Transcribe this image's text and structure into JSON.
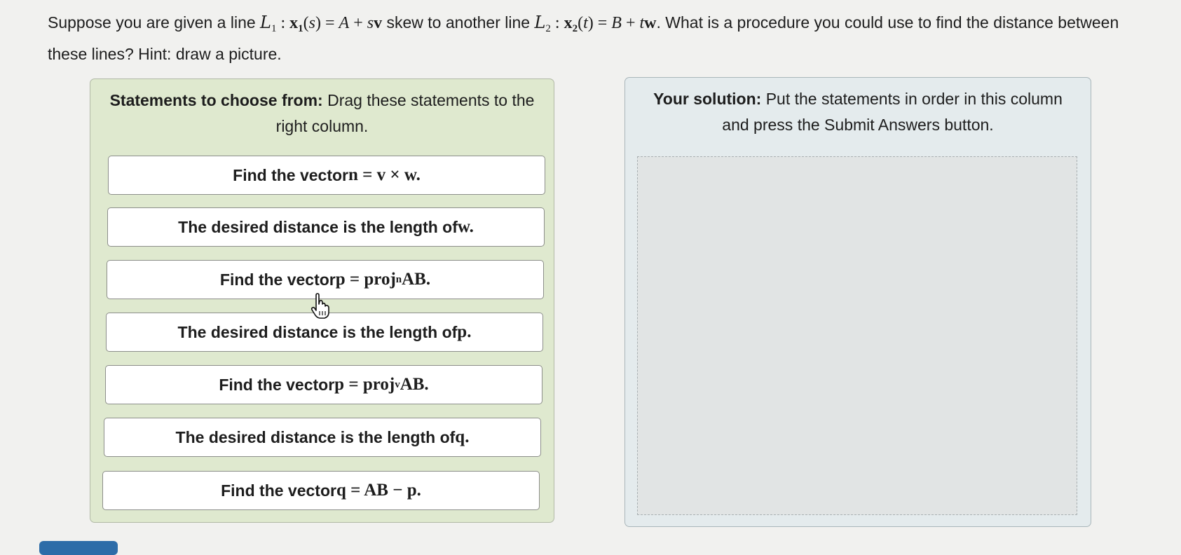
{
  "question": {
    "t1": "Suppose you are given a line ",
    "t2": " skew to another line ",
    "t3": ". What is a procedure you could use to find the distance between these lines? Hint: draw a picture.",
    "L": "L",
    "sub1": "1",
    "sub2": "2",
    "colon": ":",
    "x": "x",
    "s": "s",
    "t": "t",
    "eq": "=",
    "A": "A",
    "B": "B",
    "plus": "+",
    "v": "v",
    "w": "w",
    "lparen": "(",
    "rparen": ")"
  },
  "left_column": {
    "heading_bold": "Statements to choose from:",
    "heading_rest": " Drag these statements to the right column."
  },
  "right_column": {
    "heading_bold": "Your solution:",
    "heading_rest": " Put the statements in order in this column and press the Submit Answers button."
  },
  "statements": [
    {
      "text": "Find the vector ",
      "math": "n = v × w."
    },
    {
      "text": "The desired distance is the length of ",
      "math": "w."
    },
    {
      "text": "Find the vector ",
      "math": "p = proj",
      "sub": "n",
      "tail": "AB."
    },
    {
      "text": "The desired distance is the length of ",
      "math": "p."
    },
    {
      "text": "Find the vector ",
      "math": "p = proj",
      "sub": "v",
      "tail": "AB."
    },
    {
      "text": "The desired distance is the length of ",
      "math": "q."
    },
    {
      "text": "Find the vector ",
      "math": "q = AB − p."
    }
  ],
  "colors": {
    "left_bg": "#dfe9cf",
    "right_bg": "#e4ebed",
    "card_bg": "#ffffff"
  },
  "icons": {
    "cursor": "hand-pointer-icon"
  }
}
